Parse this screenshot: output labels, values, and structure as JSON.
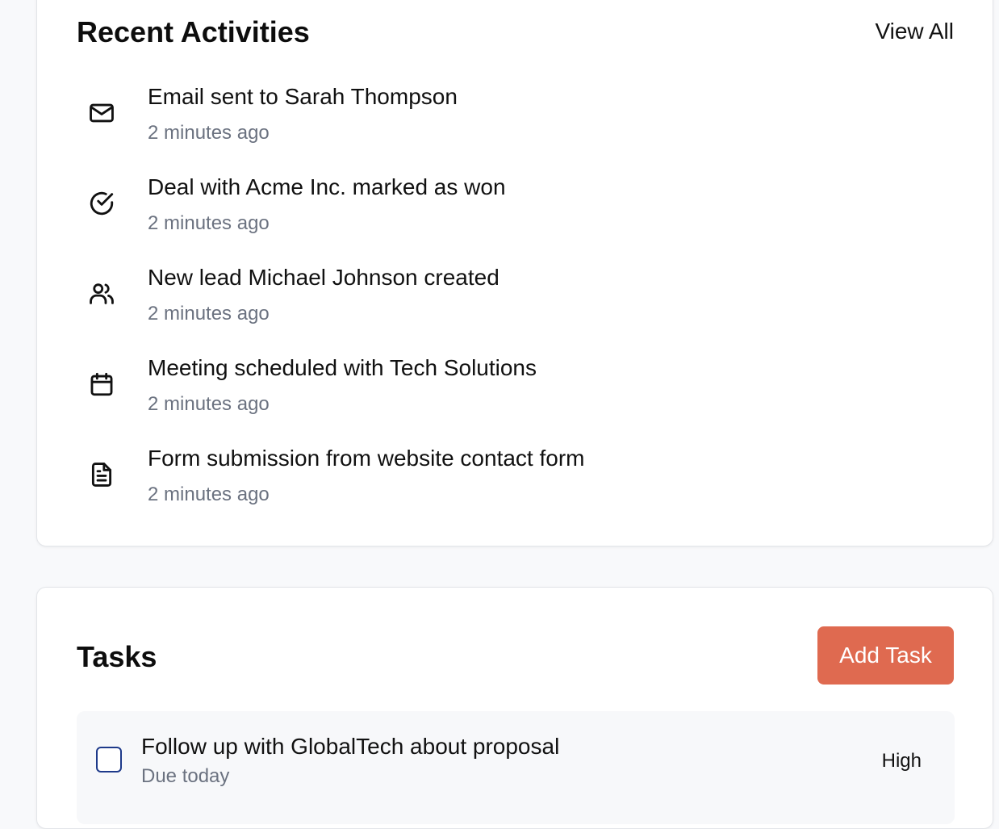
{
  "activities": {
    "title": "Recent Activities",
    "view_all_label": "View All",
    "items": [
      {
        "icon": "mail-icon",
        "title": "Email sent to Sarah Thompson",
        "time": "2 minutes ago"
      },
      {
        "icon": "check-circle-icon",
        "title": "Deal with Acme Inc. marked as won",
        "time": "2 minutes ago"
      },
      {
        "icon": "users-icon",
        "title": "New lead Michael Johnson created",
        "time": "2 minutes ago"
      },
      {
        "icon": "calendar-icon",
        "title": "Meeting scheduled with Tech Solutions",
        "time": "2 minutes ago"
      },
      {
        "icon": "document-icon",
        "title": "Form submission from website contact form",
        "time": "2 minutes ago"
      }
    ]
  },
  "tasks": {
    "title": "Tasks",
    "add_label": "Add Task",
    "accent_color": "#df6a50",
    "items": [
      {
        "title": "Follow up with GlobalTech about proposal",
        "due": "Due today",
        "priority": "High",
        "checked": false
      }
    ]
  }
}
